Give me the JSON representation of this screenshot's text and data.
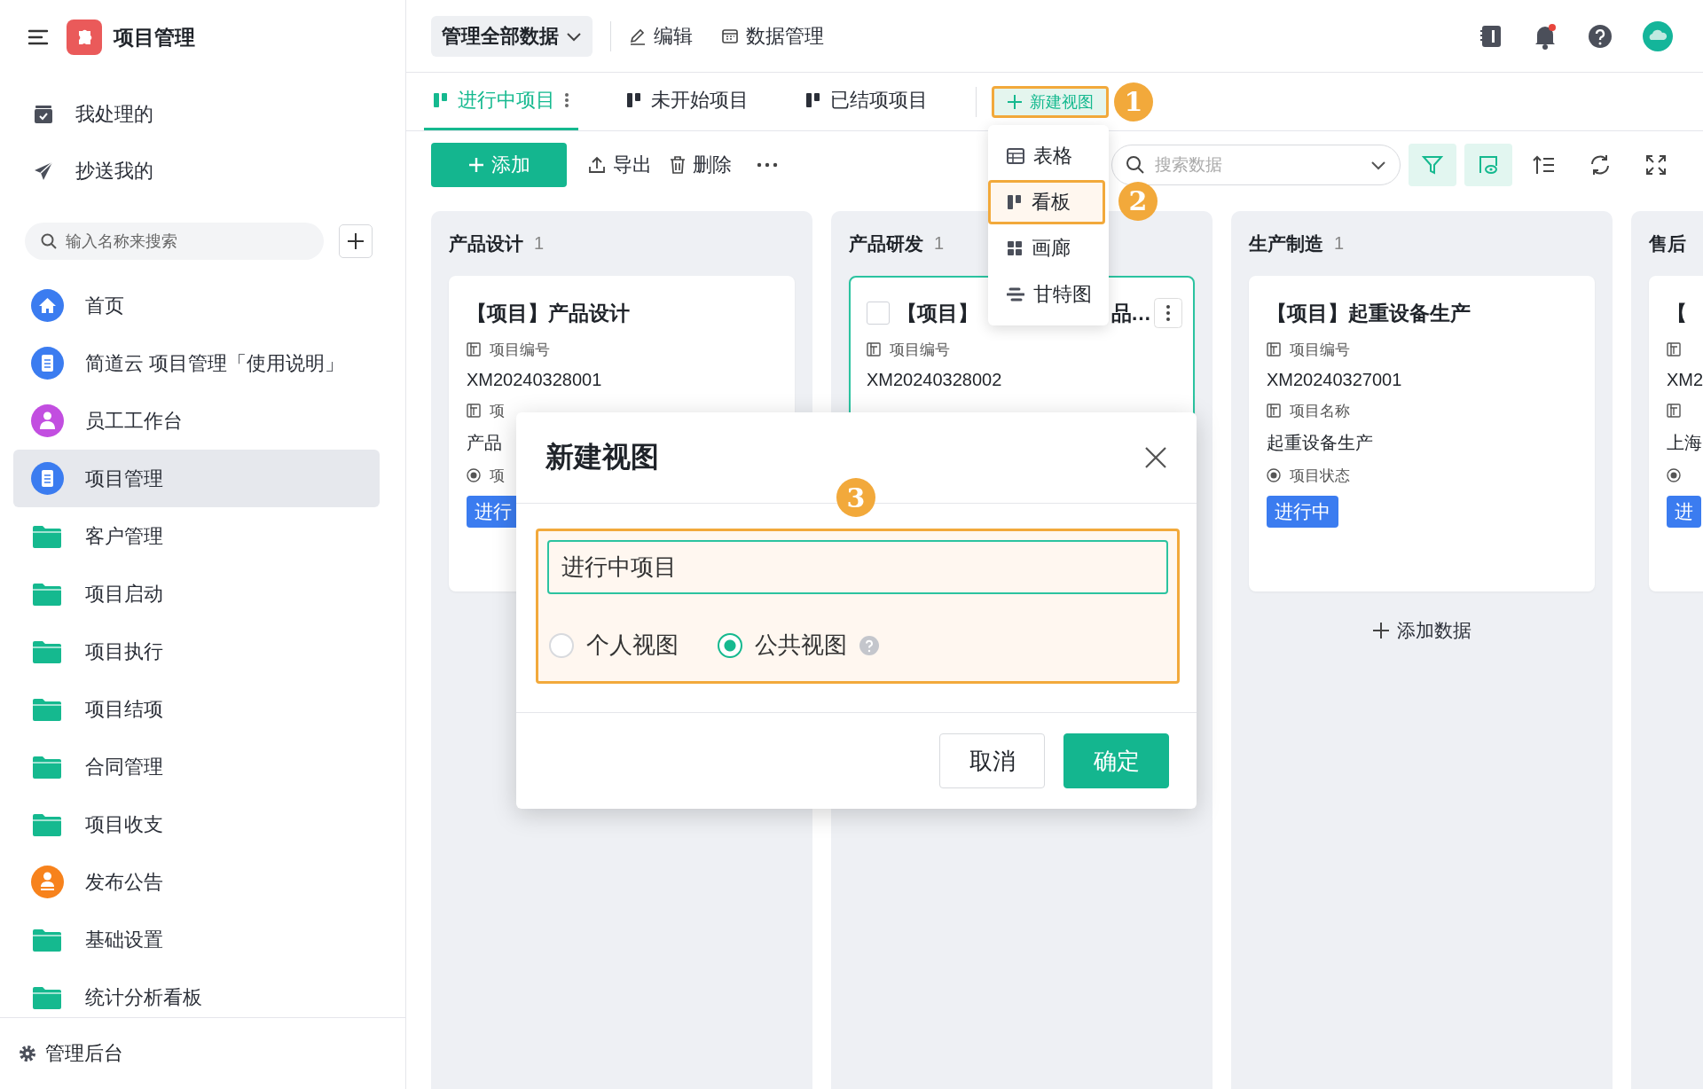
{
  "app": {
    "title": "项目管理"
  },
  "sidebar": {
    "shortcuts": [
      {
        "label": "我处理的",
        "kind": "inbox"
      },
      {
        "label": "抄送我的",
        "kind": "send"
      }
    ],
    "search": {
      "placeholder": "输入名称来搜索"
    },
    "items": [
      {
        "label": "首页",
        "kind": "home",
        "selected": false
      },
      {
        "label": "简道云 项目管理「使用说明」",
        "kind": "doc",
        "selected": false
      },
      {
        "label": "员工工作台",
        "kind": "person",
        "selected": false
      },
      {
        "label": "项目管理",
        "kind": "doc",
        "selected": true
      },
      {
        "label": "客户管理",
        "kind": "folder",
        "selected": false
      },
      {
        "label": "项目启动",
        "kind": "folder",
        "selected": false
      },
      {
        "label": "项目执行",
        "kind": "folder",
        "selected": false
      },
      {
        "label": "项目结项",
        "kind": "folder",
        "selected": false
      },
      {
        "label": "合同管理",
        "kind": "folder",
        "selected": false
      },
      {
        "label": "项目收支",
        "kind": "folder",
        "selected": false
      },
      {
        "label": "发布公告",
        "kind": "stamp",
        "selected": false
      },
      {
        "label": "基础设置",
        "kind": "folder",
        "selected": false
      },
      {
        "label": "统计分析看板",
        "kind": "folder",
        "selected": false
      }
    ],
    "footer": {
      "label": "管理后台"
    }
  },
  "topbar": {
    "scope": "管理全部数据",
    "actions": [
      {
        "label": "编辑",
        "kind": "edit"
      },
      {
        "label": "数据管理",
        "kind": "data"
      }
    ]
  },
  "tabs": [
    {
      "label": "进行中项目",
      "selected": true
    },
    {
      "label": "未开始项目",
      "selected": false
    },
    {
      "label": "已结项项目",
      "selected": false
    }
  ],
  "new_view_button": {
    "label": "新建视图",
    "highlighted": true,
    "step": "1"
  },
  "view_menu": [
    {
      "label": "表格",
      "kind": "table",
      "highlighted": false
    },
    {
      "label": "看板",
      "kind": "kanban",
      "highlighted": true,
      "step": "2"
    },
    {
      "label": "画廊",
      "kind": "gallery",
      "highlighted": false
    },
    {
      "label": "甘特图",
      "kind": "gantt",
      "highlighted": false
    }
  ],
  "toolbar": {
    "add": "添加",
    "export": "导出",
    "delete": "删除",
    "search_placeholder": "搜索数据"
  },
  "board": {
    "columns": [
      {
        "title": "产品设计",
        "count": "1",
        "cards": [
          {
            "title": "【项目】产品设计",
            "hovered": false,
            "fields": [
              {
                "kind": "text",
                "label": "项目编号",
                "value": "XM20240328001"
              },
              {
                "kind": "text",
                "label": "项",
                "value": "产品"
              },
              {
                "kind": "status",
                "label": "项",
                "value": "进行"
              }
            ]
          }
        ]
      },
      {
        "title": "产品研发",
        "count": "1",
        "cards": [
          {
            "title": "【项目】",
            "title_tail": "品…",
            "hovered": true,
            "checked": false,
            "fields": [
              {
                "kind": "text",
                "label": "项目编号",
                "value": "XM20240328002"
              }
            ]
          }
        ]
      },
      {
        "title": "生产制造",
        "count": "1",
        "add_label": "添加数据",
        "cards": [
          {
            "title": "【项目】起重设备生产",
            "hovered": false,
            "fields": [
              {
                "kind": "text",
                "label": "项目编号",
                "value": "XM20240327001"
              },
              {
                "kind": "text",
                "label": "项目名称",
                "value": "起重设备生产"
              },
              {
                "kind": "status",
                "label": "项目状态",
                "value": "进行中"
              }
            ]
          }
        ]
      },
      {
        "title": "售后",
        "cards": [
          {
            "title": "【",
            "hovered": false,
            "fields": [
              {
                "kind": "text",
                "value": "XM2"
              },
              {
                "kind": "text",
                "value": "上海"
              },
              {
                "kind": "status",
                "value": "进"
              }
            ]
          }
        ]
      }
    ]
  },
  "dialog": {
    "title": "新建视图",
    "form": {
      "highlighted": true,
      "step": "3",
      "name_value": "进行中项目",
      "visibility": [
        {
          "label": "个人视图",
          "selected": false,
          "help": false
        },
        {
          "label": "公共视图",
          "selected": true,
          "help": true
        }
      ]
    },
    "buttons": [
      {
        "label": "取消",
        "kind": "secondary"
      },
      {
        "label": "确定",
        "kind": "primary"
      }
    ]
  }
}
